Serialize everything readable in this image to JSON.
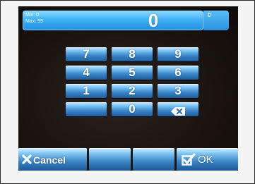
{
  "display": {
    "min_text": "Min: 0",
    "max_text": "Max: 99",
    "value": "0",
    "badge": "0"
  },
  "keypad": {
    "rows": [
      [
        "7",
        "8",
        "9"
      ],
      [
        "4",
        "5",
        "6"
      ],
      [
        "1",
        "2",
        "3"
      ],
      [
        "",
        "0",
        ""
      ]
    ],
    "backspace_icon": "backspace-icon"
  },
  "actions": {
    "cancel_label": "Cancel",
    "cancel_icon": "x-icon",
    "ok_label": "OK",
    "ok_icon": "checkbox-check-icon"
  },
  "colors": {
    "accent": "#2a96e6",
    "background": "#17110e"
  }
}
